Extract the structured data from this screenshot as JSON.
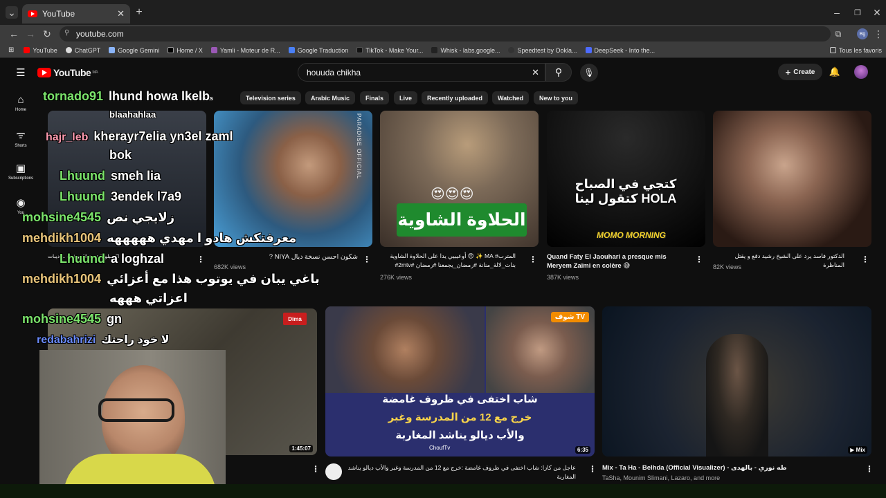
{
  "browser": {
    "tab_title": "YouTube",
    "url": "youtube.com",
    "bookmarks": [
      "YouTube",
      "ChatGPT",
      "Google Gemini",
      "Home / X",
      "Yamli - Moteur de R...",
      "Google Traduction",
      "TikTok - Make Your...",
      "Whisk - labs.google...",
      "Speedtest by Ookla...",
      "DeepSeek - Into the..."
    ],
    "all_bookmarks": "Tous les favoris"
  },
  "youtube": {
    "logo": "YouTube",
    "region": "MA",
    "search_value": "houuda chikha",
    "create_label": "Create",
    "sidebar": [
      "Home",
      "Shorts",
      "Subscriptions",
      "You"
    ],
    "chips": [
      "Cameras",
      "Television series",
      "Arabic Music",
      "Finals",
      "Live",
      "Recently uploaded",
      "Watched",
      "New to you"
    ]
  },
  "videos_row1": [
    {
      "title": "توشرة ... ديبات #funny #اكسبلور",
      "views": ""
    },
    {
      "title": "شكون احسن نسخة ديال NIYA ?",
      "views": "682K views",
      "thumb_text": "PARADISE OFFICIAL"
    },
    {
      "title": "المترب# MA ✨ 😍 أوعيبيي يدا على الحلاوة الشاوية بنات_لالة_منانة #رمضان_يجمعنا #رمضان #2mtv#",
      "views": "276K views",
      "thumb_text": "الحلاوة الشاوية",
      "thumb_emoji": "😍😍😍"
    },
    {
      "title": "Quand Faty El Jaouhari a presque mis Meryem Zaïmi en colère 😅",
      "views": "387K views",
      "thumb_text": "كتجي في الصباح كتقول لينا HOLA",
      "thumb_badge": "MOMO MORNING"
    },
    {
      "title": "الدكتور فاسد يرد على الشيخ رشيد دقع و يقتل المناظرة",
      "views": "82K views"
    }
  ],
  "videos_row2": [
    {
      "title": "",
      "duration": "1:45:07",
      "thumb_badge": "Dima"
    },
    {
      "title": "عاجل من كازا: شاب اختفى في ظروف غامضة :خرج مع 12 من المدرسة وغبر والأب ديالو يناشد المغاربة",
      "duration": "6:35",
      "thumb_text": [
        "شاب اختفى في ظروف غامضة",
        "خرج مع 12 من المدرسة وغبر",
        "والأب ديالو يناشد المغاربة"
      ],
      "thumb_footer": "ChoufTv",
      "thumb_badge": "شوف TV"
    },
    {
      "title": "Mix - Ta Ha - Belhda (Official Visualizer) - طه نوري - بالهدى",
      "subtitle": "TaSha, Mounim Slimani, Lazaro, and more",
      "duration": "Mix"
    }
  ],
  "chat": [
    {
      "name": "tornado91",
      "msg": "lhund howa lkelb",
      "color": "#7be36b"
    },
    {
      "name": "",
      "msg": "blaahahlaa",
      "color": "#ffffff"
    },
    {
      "name": "hajr_leb",
      "msg": "kherayr7elia yn3el zaml",
      "color": "#ff9bb0"
    },
    {
      "name": "",
      "msg": "bok",
      "color": "#ffffff"
    },
    {
      "name": "Lhuund",
      "msg": "smeh lia",
      "color": "#7be36b"
    },
    {
      "name": "Lhuund",
      "msg": "3endek l7a9",
      "color": "#7be36b"
    },
    {
      "name": "mohsine4545",
      "msg": "زلايجي نص",
      "color": "#7be36b"
    },
    {
      "name": "mehdikh1004",
      "msg": "معرفتكش هادو ا مهدي هههههه",
      "color": "#e8c47a"
    },
    {
      "name": "Lhuund",
      "msg": "a loghzal",
      "color": "#7be36b"
    },
    {
      "name": "mehdikh1004",
      "msg": "باغي يبان في يوتوب هذا مع أعزائي",
      "color": "#e8c47a"
    },
    {
      "name": "",
      "msg": "اعزاتي هههه",
      "color": "#ffffff"
    },
    {
      "name": "mohsine4545",
      "msg": "gn",
      "color": "#7be36b"
    },
    {
      "name": "redabahrizi",
      "msg": "لا خود راحتك",
      "color": "#6b8cff"
    }
  ]
}
